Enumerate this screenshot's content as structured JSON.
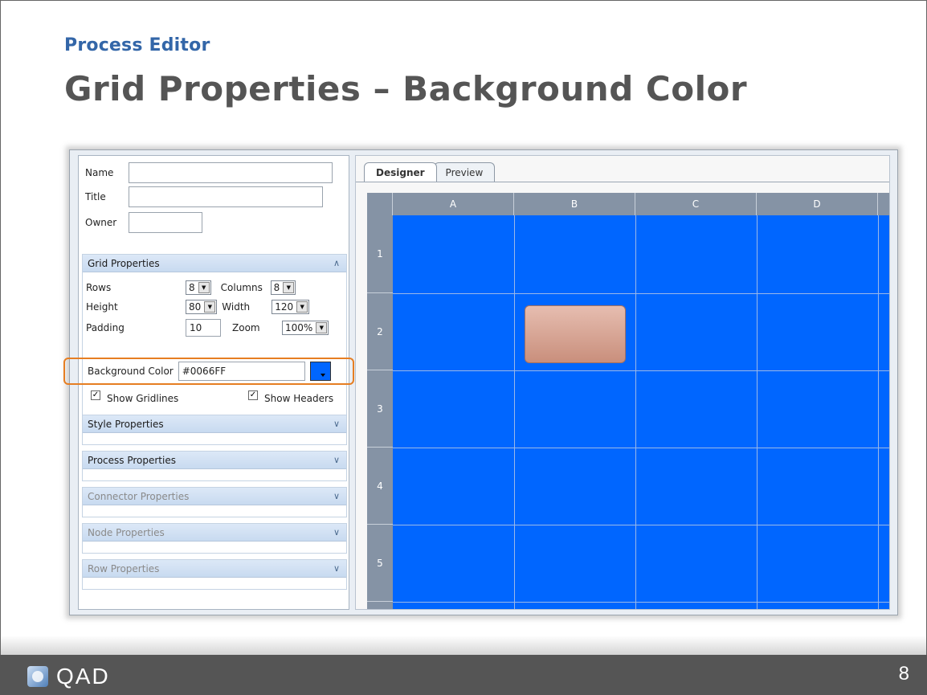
{
  "slide": {
    "kicker": "Process Editor",
    "title": "Grid Properties – Background Color",
    "page_number": "8",
    "logo_text": "QAD"
  },
  "form": {
    "name_label": "Name",
    "title_label": "Title",
    "owner_label": "Owner",
    "name_value": "",
    "title_value": "",
    "owner_value": ""
  },
  "grid_properties": {
    "header": "Grid Properties",
    "rows_label": "Rows",
    "rows_value": "8",
    "columns_label": "Columns",
    "columns_value": "8",
    "height_label": "Height",
    "height_value": "80",
    "width_label": "Width",
    "width_value": "120",
    "padding_label": "Padding",
    "padding_value": "10",
    "zoom_label": "Zoom",
    "zoom_value": "100%",
    "bg_color_label": "Background Color",
    "bg_color_value": "#0066FF",
    "show_gridlines_label": "Show Gridlines",
    "show_gridlines_checked": true,
    "show_headers_label": "Show Headers",
    "show_headers_checked": true
  },
  "sections": [
    {
      "label": "Style Properties",
      "enabled": true
    },
    {
      "label": "Process Properties",
      "enabled": true
    },
    {
      "label": "Connector Properties",
      "enabled": false
    },
    {
      "label": "Node Properties",
      "enabled": false
    },
    {
      "label": "Row Properties",
      "enabled": false
    }
  ],
  "designer": {
    "tabs": [
      {
        "label": "Designer",
        "active": true
      },
      {
        "label": "Preview",
        "active": false
      }
    ],
    "column_headers": [
      "A",
      "B",
      "C",
      "D"
    ],
    "row_headers": [
      "1",
      "2",
      "3",
      "4",
      "5"
    ],
    "grid_color": "#0066ff",
    "header_color": "#8593a5"
  },
  "colors": {
    "accent_highlight": "#e67e22",
    "kicker_color": "#3366a8",
    "footer_bg": "#555555"
  }
}
